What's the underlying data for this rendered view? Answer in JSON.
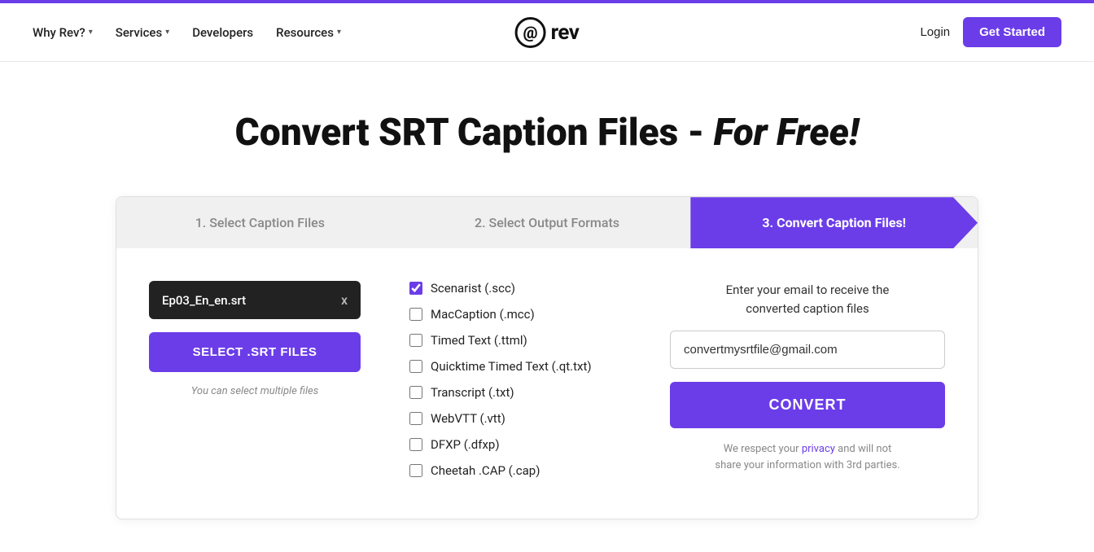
{
  "topbar": {
    "progress_fill": "100%"
  },
  "nav": {
    "items": [
      {
        "label": "Why Rev?",
        "has_dropdown": true
      },
      {
        "label": "Services",
        "has_dropdown": true
      },
      {
        "label": "Developers",
        "has_dropdown": false
      },
      {
        "label": "Resources",
        "has_dropdown": true
      }
    ],
    "logo_symbol": "@",
    "logo_text": "rev",
    "login_label": "Login",
    "get_started_label": "Get Started"
  },
  "page": {
    "title_plain": "Convert SRT Caption Files - ",
    "title_italic": "For Free!"
  },
  "steps": [
    {
      "label": "1. Select Caption Files",
      "active": false
    },
    {
      "label": "2. Select Output Formats",
      "active": false
    },
    {
      "label": "3. Convert Caption Files!",
      "active": true
    }
  ],
  "file": {
    "name": "Ep03_En_en.srt",
    "close_symbol": "x"
  },
  "select_button": "SELECT .SRT FILES",
  "multi_hint": "You can select multiple files",
  "formats": [
    {
      "label": "Scenarist (.scc)",
      "checked": true
    },
    {
      "label": "MacCaption (.mcc)",
      "checked": false
    },
    {
      "label": "Timed Text (.ttml)",
      "checked": false
    },
    {
      "label": "Quicktime Timed Text (.qt.txt)",
      "checked": false
    },
    {
      "label": "Transcript (.txt)",
      "checked": false
    },
    {
      "label": "WebVTT (.vtt)",
      "checked": false
    },
    {
      "label": "DFXP (.dfxp)",
      "checked": false
    },
    {
      "label": "Cheetah .CAP (.cap)",
      "checked": false
    }
  ],
  "email_section": {
    "label": "Enter your email to receive the\nconverted caption files",
    "placeholder": "convertmysrtfile@gmail.com",
    "value": "convertmysrtfile@gmail.com",
    "convert_button": "CONVERT",
    "privacy_note_before": "We respect your ",
    "privacy_link": "privacy",
    "privacy_note_after": " and will not\nshare your information with 3rd parties."
  }
}
